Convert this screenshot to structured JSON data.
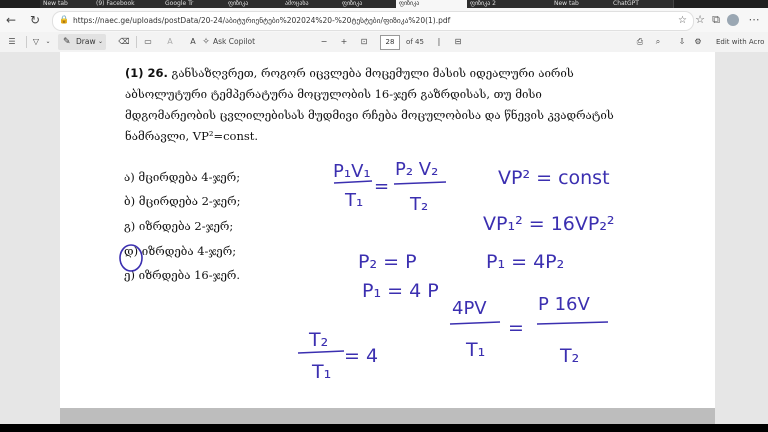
{
  "tabs": [
    {
      "label": "New tab"
    },
    {
      "label": "(9) Facebook"
    },
    {
      "label": "Google Tr"
    },
    {
      "label": "ფიზიკა"
    },
    {
      "label": "ამოცანა"
    },
    {
      "label": "ფიზიკა"
    },
    {
      "label": "ფიზიკა"
    },
    {
      "label": "ფიზიკა 2"
    },
    {
      "label": ""
    },
    {
      "label": "New tab"
    },
    {
      "label": "ChatGPT"
    }
  ],
  "address": {
    "url": "https://naec.ge/uploads/postData/20-24/აბიტურიენტები%202024%20-%20ტესტები/ფიზიკა%20(1).pdf"
  },
  "pdf_toolbar": {
    "draw_label": "Draw",
    "ask_copilot_label": "Ask Copilot",
    "zoom_minus": "−",
    "zoom_plus": "+",
    "page_current": "28",
    "page_total": "of 45",
    "edit_label": "Edit with Acro"
  },
  "question": {
    "number": "(1) 26.",
    "line1": "განსაზღვრეთ, როგორ იცვლება მოცემული მასის იდეალური აირის",
    "line2": "აბსოლუტური ტემპერატურა  მოცულობის 16-ჯერ გაზრდისას, თუ მისი",
    "line3": "მდგომარეობის ცვლილებისას მუდმივი რჩება მოცულობისა და წნევის კვადრატის",
    "line4": "ნამრავლი,  VP²=const."
  },
  "options": [
    {
      "text": "ა) მცირდება 4-ჯერ;"
    },
    {
      "text": "ბ)  მცირდება 2-ჯერ;"
    },
    {
      "text": "გ)  იზრდება 2-ჯერ;"
    },
    {
      "text": "დ) იზრდება 4-ჯერ;"
    },
    {
      "text": "ე) იზრდება 16-ჯერ."
    }
  ],
  "handwriting": {
    "eq1_left_num": "P₁V₁",
    "eq1_left_den": "T₁",
    "eq1_eq": "=",
    "eq1_right_num": "P₂ V₂",
    "eq1_right_den": "T₂",
    "vp_const": "VP² = const",
    "vp_eq": "VP₁² = 16VP₂²",
    "p2p": "P₂ = P",
    "p1_4p": "P₁ = 4 P",
    "p1_4p2": "P₁ = 4P₂",
    "ratio_num": "T₂",
    "ratio_den": "T₁",
    "ratio_eq": "= 4",
    "eq2_left_num": "4PV",
    "eq2_left_den": "T₁",
    "eq2_eq": "=",
    "eq2_right_num": "P 16V",
    "eq2_right_den": "T₂"
  },
  "colors": {
    "ink": "#3b2fb0",
    "page_bg": "#ffffff",
    "viewer_bg": "#e6e6e6"
  }
}
